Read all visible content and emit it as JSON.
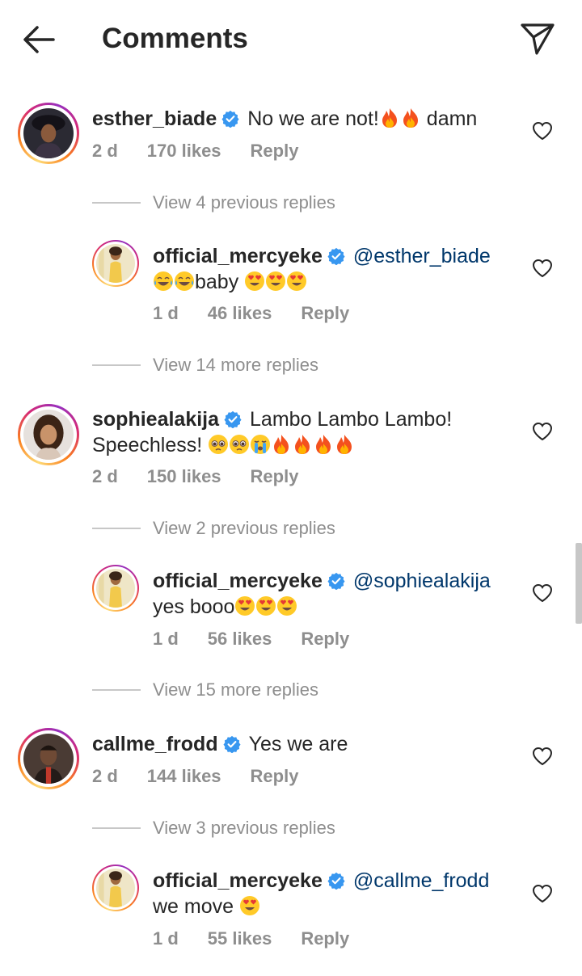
{
  "header": {
    "title": "Comments"
  },
  "icons": {
    "back": "arrow-left-icon",
    "send": "paper-plane-icon",
    "like": "heart-outline-icon",
    "verified": "verified-badge-icon"
  },
  "colors": {
    "text": "#262626",
    "muted": "#8e8e8e",
    "verified": "#3897f0",
    "mention": "#00376b",
    "heart_red": "#ed4956"
  },
  "threads": [
    {
      "comment": {
        "username": "esther_biade",
        "text": "No we are not!",
        "text_after": "damn",
        "time": "2 d",
        "likes": "170 likes",
        "reply_label": "Reply"
      },
      "view_label": "View 4 previous replies",
      "reply": {
        "username": "official_mercyeke",
        "mention": "@esther_biade",
        "text": "baby",
        "time": "1 d",
        "likes": "46 likes",
        "reply_label": "Reply"
      },
      "more_label": "View 14 more replies"
    },
    {
      "comment": {
        "username": "sophiealakija",
        "text": "Lambo Lambo Lambo! Speechless!",
        "time": "2 d",
        "likes": "150 likes",
        "reply_label": "Reply"
      },
      "view_label": "View 2 previous replies",
      "reply": {
        "username": "official_mercyeke",
        "mention": "@sophiealakija",
        "text": "yes booo",
        "time": "1 d",
        "likes": "56 likes",
        "reply_label": "Reply"
      },
      "more_label": "View 15 more replies"
    },
    {
      "comment": {
        "username": "callme_frodd",
        "text": "Yes we are",
        "time": "2 d",
        "likes": "144 likes",
        "reply_label": "Reply"
      },
      "view_label": "View 3 previous replies",
      "reply": {
        "username": "official_mercyeke",
        "mention": "@callme_frodd",
        "text": "we move",
        "time": "1 d",
        "likes": "55 likes",
        "reply_label": "Reply"
      }
    }
  ]
}
